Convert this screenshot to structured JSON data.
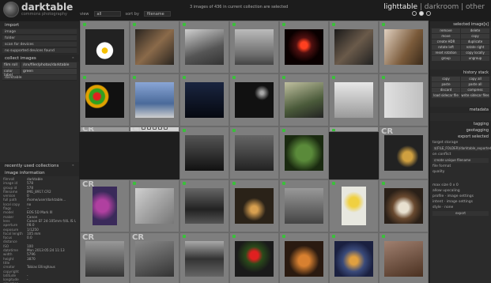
{
  "app": {
    "name": "darktable",
    "tagline": "commons photography"
  },
  "status": "3 images of 436 in current collection are selected",
  "modules": {
    "lighttable": "lighttable",
    "darkroom": "darkroom",
    "other": "other"
  },
  "toolbar": {
    "view_label": "view",
    "view_value": "all",
    "sort_label": "sort by",
    "sort_value": "filename"
  },
  "left": {
    "import": {
      "title": "import",
      "buttons": [
        "image",
        "folder",
        "scan for devices",
        "no supported devices found"
      ]
    },
    "collect": {
      "title": "collect images",
      "rows": [
        [
          "film roll",
          "/srv/filer/photos/darktable"
        ],
        [
          "color label",
          "green"
        ]
      ],
      "extra": "darktable"
    },
    "recent": {
      "title": "recently used collections"
    },
    "info": {
      "title": "image information",
      "rows": [
        [
          "filmroll",
          "darktable"
        ],
        [
          "image id",
          "578"
        ],
        [
          "group id",
          "578"
        ],
        [
          "filename",
          "IMG_8917.CR2"
        ],
        [
          "version",
          "0"
        ],
        [
          "full path",
          "/home/user/darktable..."
        ],
        [
          "local copy",
          "no"
        ],
        [
          "flags",
          "--"
        ],
        [
          "model",
          "EOS 5D Mark III"
        ],
        [
          "maker",
          "Canon"
        ],
        [
          "lens",
          "Canon EF 24-105mm f/4L IS USM"
        ],
        [
          "aperture",
          "f/8.0"
        ],
        [
          "exposure",
          "1/1250"
        ],
        [
          "focal length",
          "105 mm"
        ],
        [
          "focus distance",
          "0.0"
        ],
        [
          "ISO",
          "100"
        ],
        [
          "datetime",
          "Mon 2013:05:24 11:13"
        ],
        [
          "width",
          "5796"
        ],
        [
          "height",
          "3870"
        ],
        [
          "title",
          ""
        ],
        [
          "creator",
          "Tobias Ellinghaus"
        ],
        [
          "copyright",
          ""
        ],
        [
          "latitude",
          "-"
        ],
        [
          "longitude",
          "-"
        ],
        [
          "elevation",
          "-"
        ]
      ]
    }
  },
  "right": {
    "selected": {
      "title": "selected image[s]",
      "buttons": [
        "remove",
        "delete",
        "move",
        "copy",
        "create HDR",
        "duplicate",
        "rotate left",
        "rotate right",
        "reset rotation",
        "copy locally",
        "group",
        "ungroup"
      ]
    },
    "history": {
      "title": "history stack",
      "buttons": [
        "copy",
        "copy all",
        "paste",
        "paste all",
        "discard",
        "compress",
        "load sidecar file",
        "write sidecar files"
      ]
    },
    "metadata": {
      "title": "metadata"
    },
    "tagging": {
      "title": "tagging"
    },
    "geotag": {
      "title": "geotagging"
    },
    "export": {
      "title": "export selected",
      "target": "target storage",
      "path": "$(FILE_FOLDER)/darktable_exported/$(FILE_NAME)",
      "on_conflict": "on conflict",
      "conflict_value": "create unique filename",
      "format": "file format",
      "quality": "quality",
      "size": "max size",
      "size_w": "0",
      "size_h": "0",
      "upscale": "allow upscaling",
      "profile": "profile",
      "profile_value": "image settings",
      "intent": "intent",
      "intent_value": "image settings",
      "style": "style",
      "style_value": "none",
      "export_button": "export"
    }
  },
  "thumbs": [
    {
      "c": "#1a1a1a",
      "g": "radial-gradient(circle at 50% 60%, #f6c000 0 10%, #fff 11% 28%, #222 30%)"
    },
    {
      "c": "#5a4a3a",
      "g": "linear-gradient(135deg,#2a2520,#8a6a4a 50%,#2a2520)"
    },
    {
      "c": "#888",
      "g": "linear-gradient(160deg,#cfcfcf,#555 60%,#333)"
    },
    {
      "c": "#9a9a9a",
      "g": "linear-gradient(180deg,#bbb,#6f6f6f 70%,#444)"
    },
    {
      "c": "#200",
      "g": "radial-gradient(circle at 50% 45%, #ff4020 0 12%, #501010 28%, #0a0000 60%)"
    },
    {
      "c": "#3a3a3a",
      "g": "linear-gradient(135deg,#1a1a1a,#6a5a4a 50%,#222)"
    },
    {
      "c": "#8a7a6a",
      "g": "linear-gradient(120deg,#e0d0c0,#7a5a3a 60%,#3a2a1a)"
    },
    {
      "c": "#111",
      "g": "radial-gradient(circle at 30% 40%, #e02020 0 10%, #30a020 14% 22%, #e0a000 25% 32%, #111 35%)"
    },
    {
      "c": "#4a6a9a",
      "g": "linear-gradient(180deg,#8aa6d6,#4a6a9a 60%,#cfcfcf)"
    },
    {
      "c": "#0a1020",
      "g": "linear-gradient(180deg,#1a2540,#050810)"
    },
    {
      "c": "#0a0a0a",
      "g": "radial-gradient(circle at 70% 30%, #aaa 0 4%, #111 20%)"
    },
    {
      "c": "#4a5a3a",
      "g": "linear-gradient(160deg,#c0c0a0,#4a5a3a 60%,#222)"
    },
    {
      "c": "#cfcfcf",
      "g": "linear-gradient(180deg,#e8e8e8,#9a9a9a)"
    },
    {
      "c": "#cfcfcf",
      "g": "linear-gradient(90deg,#e0e0e0,#c0c0c0)"
    },
    {
      "c": "#777",
      "g": "linear-gradient(180deg,#aaa,#444)"
    },
    {
      "c": "#b6a890",
      "g": "linear-gradient(135deg,#c8b89c,#9a8a72)"
    },
    {
      "c": "#222",
      "g": "linear-gradient(180deg,#555,#111)"
    },
    {
      "c": "#333",
      "g": "linear-gradient(180deg,#666,#222)"
    },
    {
      "c": "#2a3a1a",
      "g": "radial-gradient(circle at 50% 50%, #5a8a3a 0 30%, #1a2a10 70%)"
    },
    {
      "c": "#3a3a30",
      "g": "radial-gradient(circle at 50% 55%, #d0d0b0 0 18%, #3a3a30 40%)"
    },
    {
      "c": "#2a2a2a",
      "g": "radial-gradient(circle at 60% 60%, #d0a040 0 15%, #222 35%)"
    },
    {
      "c": "#5a3a6a",
      "g": "radial-gradient(circle at 40% 50%, #b040a0 0 25%, #3a2a5a 60%)"
    },
    {
      "c": "#aaa",
      "g": "linear-gradient(135deg,#cfcfcf,#777)"
    },
    {
      "c": "#333",
      "g": "linear-gradient(180deg,#666,#222 60%,#555)"
    },
    {
      "c": "#2a2218",
      "g": "radial-gradient(circle at 50% 60%, #d8a050 0 12%, #2a2218 40%)"
    },
    {
      "c": "#777",
      "g": "linear-gradient(180deg,#999,#444)"
    },
    {
      "c": "#e8e8e0",
      "g": "radial-gradient(circle at 50% 40%, #f0d040 0 18%, #e8e8e0 40%)"
    },
    {
      "c": "#5a4a3a",
      "g": "radial-gradient(circle at 50% 55%, #e8e0d0 0 18%, #6a4a30 40%, #2a2018 70%)"
    },
    {
      "c": "#666",
      "g": "linear-gradient(180deg,#999,#333)"
    },
    {
      "c": "#555",
      "g": "linear-gradient(160deg,#888,#333)"
    },
    {
      "c": "#444",
      "g": "linear-gradient(180deg,#aaa,#333 50%,#666)"
    },
    {
      "c": "#2a2a2a",
      "g": "radial-gradient(circle at 50% 40%, #e02020 0 14%, #2a4a1a 30%, #1a1a1a 60%)"
    },
    {
      "c": "#3a2a1a",
      "g": "radial-gradient(circle at 50% 55%, #d88030 0 20%, #2a1a10 55%)"
    },
    {
      "c": "#4a5a7a",
      "g": "radial-gradient(circle at 50% 55%, #e0a040 0 14%, #3a4a7a 40%, #1a2040 70%)"
    },
    {
      "c": "#6a5040",
      "g": "linear-gradient(160deg,#a08070,#4a3020)"
    }
  ]
}
